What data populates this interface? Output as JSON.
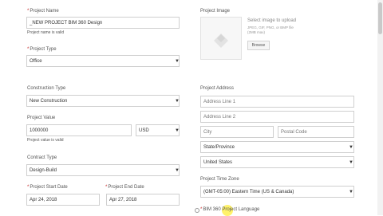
{
  "project_name": {
    "label": "Project Name",
    "value": "_NEW PROJECT BIM 360 Design",
    "hint": "Project name is valid"
  },
  "project_type": {
    "label": "Project Type",
    "value": "Office"
  },
  "project_image": {
    "label": "Project Image",
    "select_text": "Select image to upload",
    "formats": "JPEG, GIF, PNG, or BMP file",
    "size_limit": "(2MB max)",
    "browse_label": "Browse"
  },
  "construction_type": {
    "label": "Construction Type",
    "value": "New Construction"
  },
  "project_value": {
    "label": "Project Value",
    "value": "1000000",
    "currency": "USD",
    "hint": "Project value is valid"
  },
  "contract_type": {
    "label": "Contract Type",
    "value": "Design-Build"
  },
  "start_date": {
    "label": "Project Start Date",
    "value": "Apr 24, 2018"
  },
  "end_date": {
    "label": "Project End Date",
    "value": "Apr 27, 2018"
  },
  "project_address": {
    "label": "Project Address",
    "line1_placeholder": "Address Line 1",
    "line2_placeholder": "Address Line 2",
    "city_placeholder": "City",
    "postal_placeholder": "Postal Code",
    "state_placeholder": "State/Province",
    "country": "United States"
  },
  "time_zone": {
    "label": "Project Time Zone",
    "value": "(GMT-05:00) Eastern Time (US & Canada)"
  },
  "language": {
    "label": "BIM 360 Project Language",
    "label_partial_left": "BIM 360",
    "label_partial_right": "Project Language"
  },
  "required_marker": "*",
  "caret_glyph": "▼"
}
